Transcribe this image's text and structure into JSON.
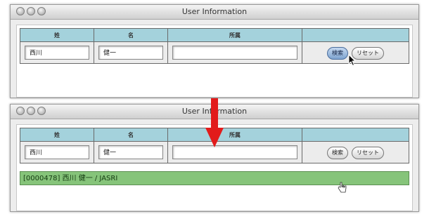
{
  "windows": [
    {
      "title": "User Information",
      "headers": [
        "姓",
        "名",
        "所属"
      ],
      "values": [
        "西川",
        "健一",
        ""
      ],
      "search_label": "検索",
      "reset_label": "リセット",
      "result": ""
    },
    {
      "title": "User Information",
      "headers": [
        "姓",
        "名",
        "所属"
      ],
      "values": [
        "西川",
        "健一",
        ""
      ],
      "search_label": "検索",
      "reset_label": "リセット",
      "result": "[0000478] 西川 健一 / JASRI"
    }
  ],
  "colors": {
    "header_bg": "#a4d2dc",
    "result_bg": "#86c47a",
    "arrow": "#e21b1b"
  }
}
